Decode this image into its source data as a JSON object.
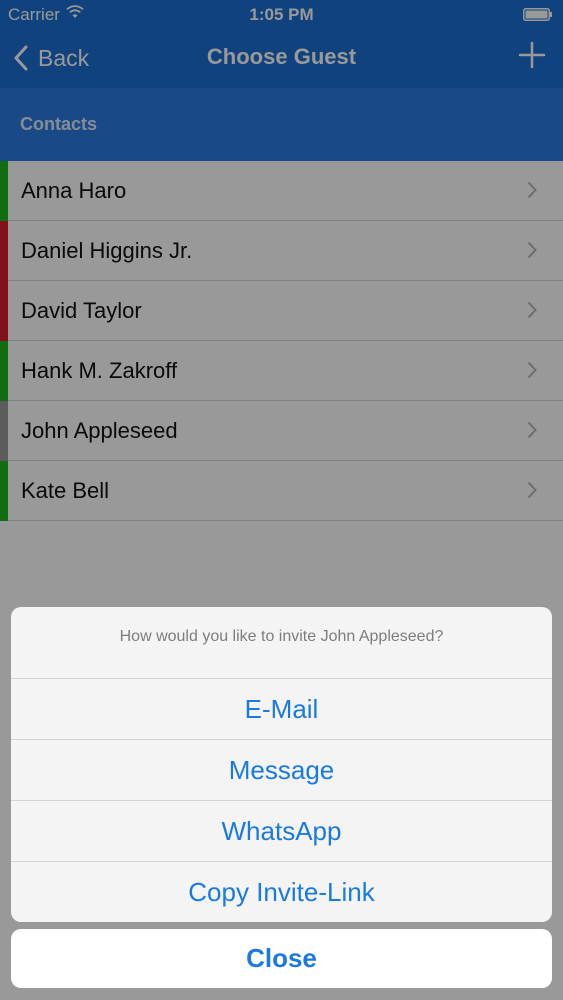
{
  "status_bar": {
    "carrier": "Carrier",
    "time": "1:05 PM"
  },
  "nav": {
    "back_label": "Back",
    "title": "Choose Guest",
    "add_icon": "plus-icon"
  },
  "section": {
    "title": "Contacts"
  },
  "contacts": [
    {
      "name": "Anna Haro",
      "color": "#1fb51f"
    },
    {
      "name": "Daniel Higgins Jr.",
      "color": "#d41f2e"
    },
    {
      "name": "David Taylor",
      "color": "#d41f2e"
    },
    {
      "name": "Hank M. Zakroff",
      "color": "#1fb51f"
    },
    {
      "name": "John Appleseed",
      "color": "#9a9a9a"
    },
    {
      "name": "Kate Bell",
      "color": "#1fb51f"
    }
  ],
  "action_sheet": {
    "message": "How would you like to invite John Appleseed?",
    "options": [
      "E-Mail",
      "Message",
      "WhatsApp",
      "Copy Invite-Link"
    ],
    "close_label": "Close"
  },
  "colors": {
    "nav_blue": "#1c6fd0",
    "section_blue": "#2b7be0",
    "action_blue": "#1a7ae0"
  }
}
